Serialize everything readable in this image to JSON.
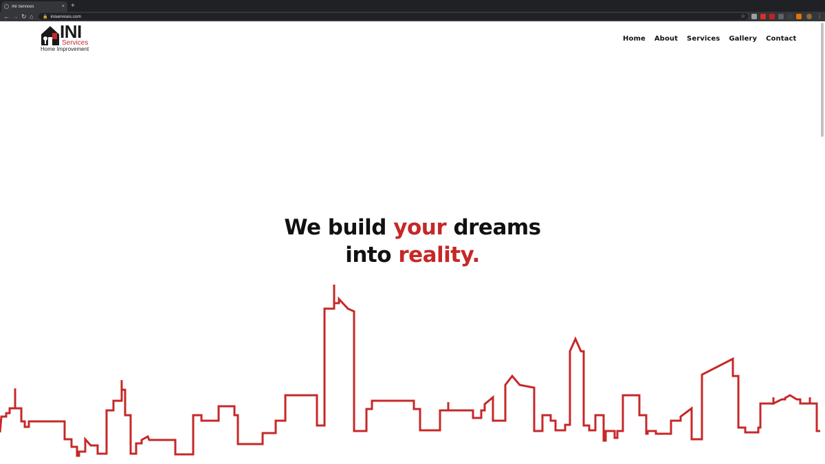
{
  "browser": {
    "tab_title": "INI Services",
    "tab_close": "×",
    "new_tab": "+",
    "url": "iniservices.com",
    "lock": "🔒"
  },
  "logo": {
    "mark": "INI",
    "sub": "Services",
    "tagline": "Home Improvement"
  },
  "nav": {
    "items": [
      "Home",
      "About",
      "Services",
      "Gallery",
      "Contact"
    ]
  },
  "hero": {
    "line1_a": "We build ",
    "line1_b": "your",
    "line1_c": " dreams",
    "line2_a": "into ",
    "line2_b": "reality."
  },
  "colors": {
    "accent": "#c62828",
    "text": "#111111",
    "chrome_dark": "#202124",
    "chrome": "#35363a"
  },
  "icons": [
    "back-icon",
    "forward-icon",
    "reload-icon",
    "home-icon",
    "lock-icon",
    "star-icon",
    "menu-icon",
    "skyline-illustration"
  ]
}
